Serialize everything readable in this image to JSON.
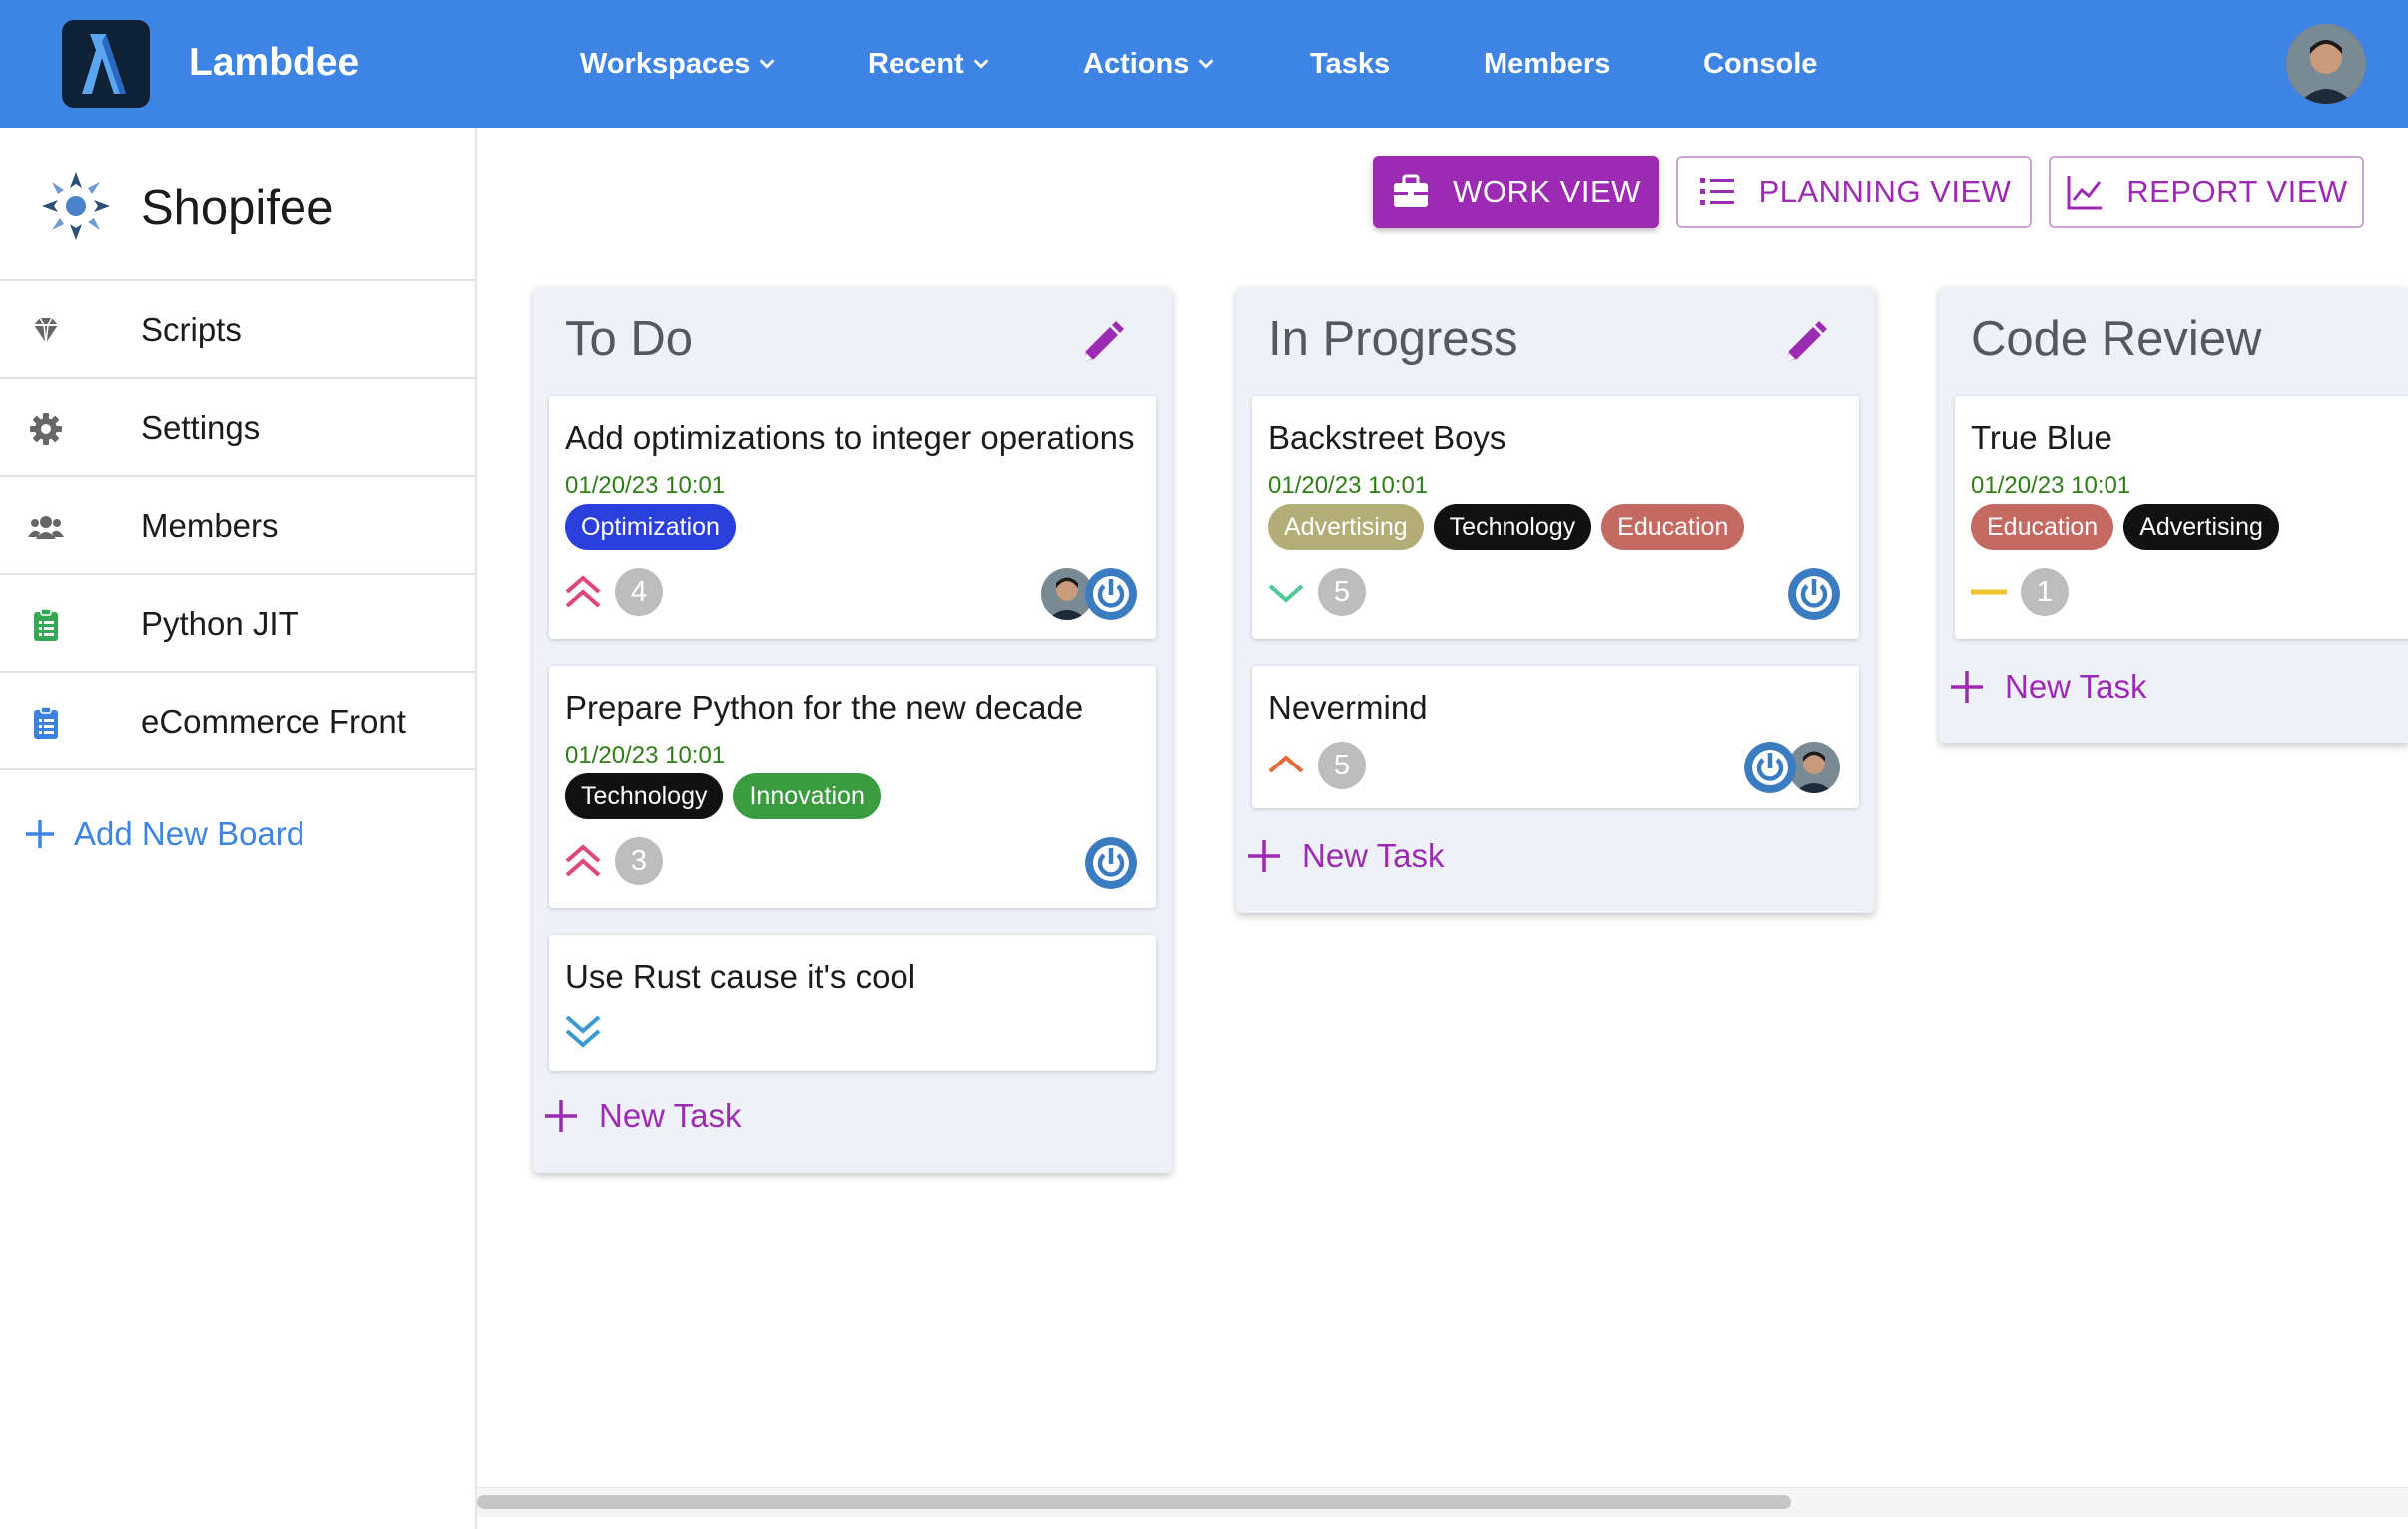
{
  "topbar": {
    "app_title": "Lambdee",
    "nav": [
      {
        "label": "Workspaces",
        "has_dropdown": true
      },
      {
        "label": "Recent",
        "has_dropdown": true
      },
      {
        "label": "Actions",
        "has_dropdown": true
      },
      {
        "label": "Tasks",
        "has_dropdown": false
      },
      {
        "label": "Members",
        "has_dropdown": false
      },
      {
        "label": "Console",
        "has_dropdown": false
      }
    ],
    "color": "#3e84e4"
  },
  "sidebar": {
    "board_title": "Shopifee",
    "items": [
      {
        "label": "Scripts",
        "icon": "gem-icon"
      },
      {
        "label": "Settings",
        "icon": "gear-icon"
      },
      {
        "label": "Members",
        "icon": "users-icon"
      },
      {
        "label": "Python JIT",
        "icon": "clipboard-icon"
      },
      {
        "label": "eCommerce Front",
        "icon": "clipboard-icon"
      }
    ],
    "add_board_label": "Add New Board"
  },
  "views": {
    "work": "WORK VIEW",
    "planning": "PLANNING VIEW",
    "report": "REPORT VIEW",
    "active": "work",
    "accent": "#9c2ab2"
  },
  "columns": [
    {
      "title": "To Do",
      "new_task_label": "New Task",
      "cards": [
        {
          "title": "Add optimizations to integer operations",
          "date": "01/20/23 10:01",
          "tags": [
            {
              "label": "Optimization",
              "color": "#2a3fdc"
            }
          ],
          "priority": "highest",
          "points": "4",
          "assignees": [
            "user-avatar",
            "power-avatar"
          ]
        },
        {
          "title": "Prepare Python for the new decade",
          "date": "01/20/23 10:01",
          "tags": [
            {
              "label": "Technology",
              "color": "#111111"
            },
            {
              "label": "Innovation",
              "color": "#3b9c3f"
            }
          ],
          "priority": "highest",
          "points": "3",
          "assignees": [
            "power-avatar"
          ]
        },
        {
          "title": "Use Rust cause it's cool",
          "priority": "lowest"
        }
      ]
    },
    {
      "title": "In Progress",
      "new_task_label": "New Task",
      "cards": [
        {
          "title": "Backstreet Boys",
          "date": "01/20/23 10:01",
          "tags": [
            {
              "label": "Advertising",
              "color": "#b3ae78"
            },
            {
              "label": "Technology",
              "color": "#111111"
            },
            {
              "label": "Education",
              "color": "#c46a63"
            }
          ],
          "priority": "low",
          "points": "5",
          "assignees": [
            "power-avatar"
          ]
        },
        {
          "title": "Nevermind",
          "priority": "high",
          "points": "5",
          "assignees": [
            "power-avatar",
            "user-avatar"
          ]
        }
      ]
    },
    {
      "title": "Code Review",
      "new_task_label": "New Task",
      "cards": [
        {
          "title": "True Blue",
          "date": "01/20/23 10:01",
          "tags": [
            {
              "label": "Education",
              "color": "#c46a63"
            },
            {
              "label": "Advertising",
              "color": "#111111"
            }
          ],
          "priority": "medium",
          "points": "1"
        }
      ]
    }
  ]
}
